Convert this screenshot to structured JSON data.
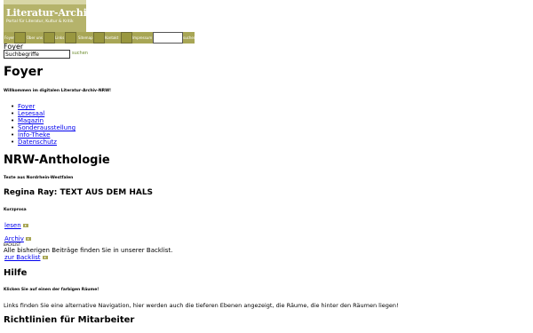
{
  "header": {
    "logo_title": "Literatur-Archiv-NRW",
    "logo_tagline": "Portal für Literatur, Kultur & Kritik"
  },
  "nav": {
    "items": [
      "Foyer",
      "Über uns",
      "Links",
      "Sitemap",
      "Kontakt",
      "Impressum"
    ],
    "go_label": "suchen"
  },
  "breadcrumb": "Foyer",
  "search": {
    "value": "Suchbegriffe",
    "button": "suchen"
  },
  "foyer": {
    "title": "Foyer",
    "welcome": "Willkommen im digitalen Literatur-Archiv-NRW!",
    "links": [
      "Foyer",
      "Lesesaal",
      "Magazin",
      "Sonderausstellung",
      "Info-Theke",
      "Datenschutz"
    ]
  },
  "anthology": {
    "title": "NRW-Anthologie",
    "subtitle": "Texte aus Nordrhein-Westfalen",
    "work_title": "Regina Ray: TEXT AUS DEM HALS",
    "genre": "Kurzprosa",
    "read_link": "lesen",
    "archive_link": "Archiv",
    "backlist_tag": "BACKLIST",
    "backlist_text": "Alle bisherigen Beiträge finden Sie in unserer Backlist.",
    "backlist_link": "zur Backlist"
  },
  "help": {
    "title": "Hilfe",
    "subtitle": "Klicken Sie auf einen der farbigen Räume!",
    "text": "Links finden Sie eine alternative Navigation, hier werden auch die tieferen Ebenen angezeigt, die Räume, die hinter den Räumen liegen!"
  },
  "guidelines": {
    "title": "Richtlinien für Mitarbeiter"
  },
  "colors": {
    "brand_olive": "#a8a655",
    "logo_bg": "#b5b36b",
    "link": "#0000ee"
  }
}
